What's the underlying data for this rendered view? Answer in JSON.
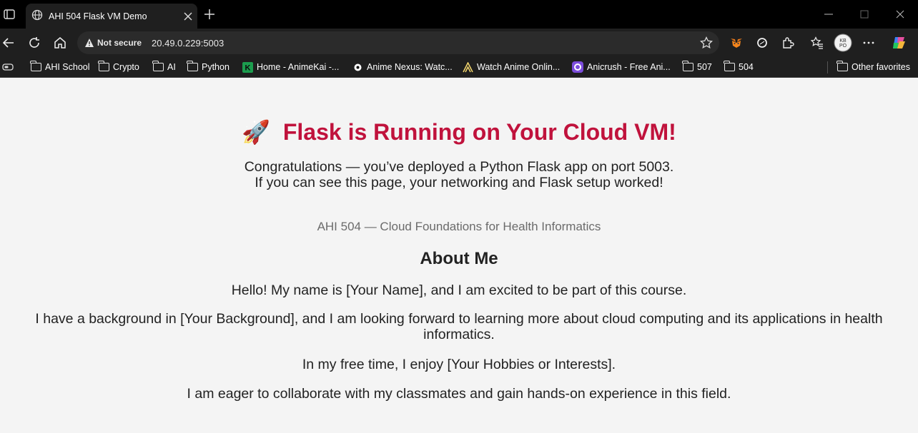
{
  "browser": {
    "tab_title": "AHI 504 Flask VM Demo",
    "not_secure_label": "Not secure",
    "url": "20.49.0.229:5003",
    "bookmarks": [
      {
        "label": "AHI School",
        "icon": "folder-icon"
      },
      {
        "label": "Crypto",
        "icon": "folder-icon"
      },
      {
        "label": "AI",
        "icon": "folder-icon"
      },
      {
        "label": "Python",
        "icon": "folder-icon"
      },
      {
        "label": "Home - AnimeKai -...",
        "icon": "animekai-icon"
      },
      {
        "label": "Anime Nexus: Watc...",
        "icon": "animenexus-icon"
      },
      {
        "label": "Watch Anime Onlin...",
        "icon": "anime-site-icon"
      },
      {
        "label": "Anicrush - Free Ani...",
        "icon": "anicrush-icon"
      },
      {
        "label": "507",
        "icon": "folder-icon"
      },
      {
        "label": "504",
        "icon": "folder-icon"
      }
    ],
    "other_favorites_label": "Other favorites",
    "colors": {
      "chrome_bg": "#000000",
      "toolbar_bg": "#1f1f1f",
      "omnibox_bg": "#2b2b2b"
    }
  },
  "page": {
    "title_emoji": "🚀",
    "title": "Flask is Running on Your Cloud VM!",
    "intro_line1": "Congratulations — you’ve deployed a Python Flask app on port 5003.",
    "intro_line2": "If you can see this page, your networking and Flask setup worked!",
    "course": "AHI 504 — Cloud Foundations for Health Informatics",
    "about_heading": "About Me",
    "para1": "Hello! My name is [Your Name], and I am excited to be part of this course.",
    "para2": "I have a background in [Your Background], and I am looking forward to learning more about cloud computing and its applications in health informatics.",
    "para3": "In my free time, I enjoy [Your Hobbies or Interests].",
    "para4": "I am eager to collaborate with my classmates and gain hands-on experience in this field.",
    "colors": {
      "title": "#c0123c",
      "body_text": "#222222",
      "muted_text": "#6b6b6b",
      "background": "#f4f4f4"
    }
  }
}
